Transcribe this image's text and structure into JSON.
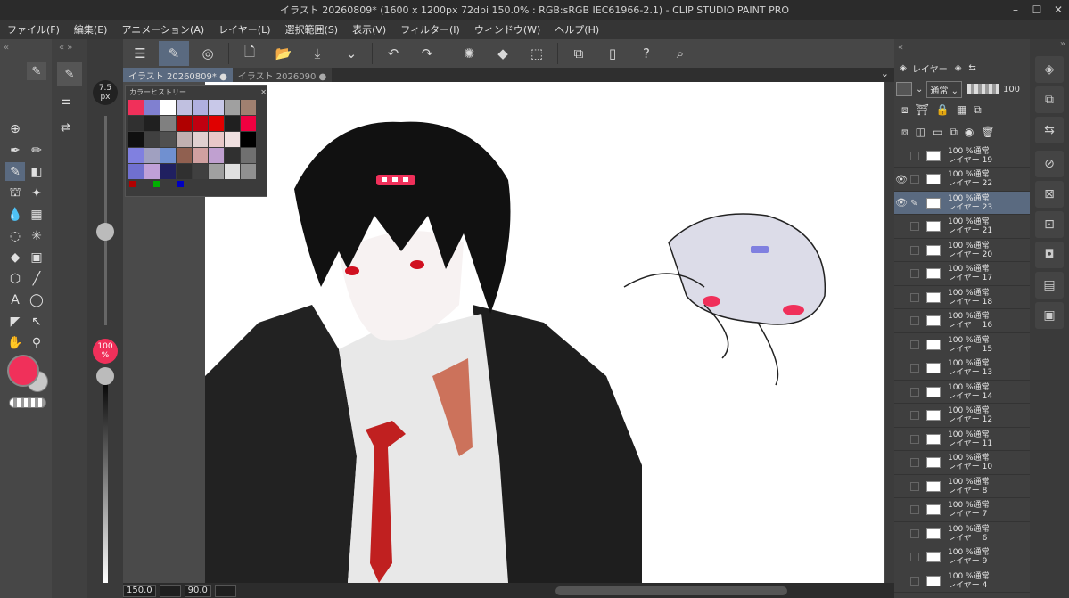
{
  "window": {
    "title": "イラスト 20260809* (1600 x 1200px 72dpi 150.0% : RGB:sRGB IEC61966-2.1) - CLIP STUDIO PAINT PRO",
    "min_icon": "minimize-icon",
    "max_icon": "maximize-icon",
    "close_icon": "close-icon"
  },
  "menu": [
    "ファイル(F)",
    "編集(E)",
    "アニメーション(A)",
    "レイヤー(L)",
    "選択範囲(S)",
    "表示(V)",
    "フィルター(I)",
    "ウィンドウ(W)",
    "ヘルプ(H)"
  ],
  "tabs": [
    {
      "label": "イラスト 20260809*",
      "active": true
    },
    {
      "label": "イラスト 2026090",
      "active": false
    }
  ],
  "brush": {
    "size": "7.5",
    "unit": "px",
    "opacity": "100",
    "opacity_unit": "%"
  },
  "colors": {
    "main": "#f0305a",
    "sub": "#c8c8c8",
    "accent": "#5a6a80"
  },
  "color_history": {
    "title": "カラーヒストリー",
    "swatches": [
      "#f0305a",
      "#8080d0",
      "#ffffff",
      "#c0c0e0",
      "#b0b0e0",
      "#c8c8e8",
      "#a0a0a0",
      "#a08070",
      "#303030",
      "#202020",
      "#808080",
      "#b00000",
      "#c00010",
      "#e00000",
      "#202020",
      "#f00040",
      "#101010",
      "#404040",
      "#505050",
      "#c0b0b0",
      "#e0d0d0",
      "#e8c8c8",
      "#f0e0e0",
      "#000000",
      "#8080e0",
      "#a0a0c0",
      "#7090d0",
      "#906050",
      "#d0a0a0",
      "#c0a0d0",
      "#303030",
      "#707070",
      "#7070d0",
      "#c0a0d8",
      "#202060",
      "#303030",
      "#404040",
      "#a0a0a0",
      "#e0e0e0",
      "#909090"
    ]
  },
  "layer_panel": {
    "header": "レイヤー",
    "blend_mode": "通常",
    "opacity": "100",
    "layers": [
      {
        "pct": "100 %通常",
        "name": "レイヤー 19",
        "visible": false,
        "selected": false
      },
      {
        "pct": "100 %通常",
        "name": "レイヤー 22",
        "visible": true,
        "selected": false
      },
      {
        "pct": "100 %通常",
        "name": "レイヤー 23",
        "visible": true,
        "selected": true
      },
      {
        "pct": "100 %通常",
        "name": "レイヤー 21",
        "visible": false,
        "selected": false
      },
      {
        "pct": "100 %通常",
        "name": "レイヤー 20",
        "visible": false,
        "selected": false
      },
      {
        "pct": "100 %通常",
        "name": "レイヤー 17",
        "visible": false,
        "selected": false
      },
      {
        "pct": "100 %通常",
        "name": "レイヤー 18",
        "visible": false,
        "selected": false
      },
      {
        "pct": "100 %通常",
        "name": "レイヤー 16",
        "visible": false,
        "selected": false
      },
      {
        "pct": "100 %通常",
        "name": "レイヤー 15",
        "visible": false,
        "selected": false
      },
      {
        "pct": "100 %通常",
        "name": "レイヤー 13",
        "visible": false,
        "selected": false
      },
      {
        "pct": "100 %通常",
        "name": "レイヤー 14",
        "visible": false,
        "selected": false
      },
      {
        "pct": "100 %通常",
        "name": "レイヤー 12",
        "visible": false,
        "selected": false
      },
      {
        "pct": "100 %通常",
        "name": "レイヤー 11",
        "visible": false,
        "selected": false
      },
      {
        "pct": "100 %通常",
        "name": "レイヤー 10",
        "visible": false,
        "selected": false
      },
      {
        "pct": "100 %通常",
        "name": "レイヤー 8",
        "visible": false,
        "selected": false
      },
      {
        "pct": "100 %通常",
        "name": "レイヤー 7",
        "visible": false,
        "selected": false
      },
      {
        "pct": "100 %通常",
        "name": "レイヤー 6",
        "visible": false,
        "selected": false
      },
      {
        "pct": "100 %通常",
        "name": "レイヤー 9",
        "visible": false,
        "selected": false
      },
      {
        "pct": "100 %通常",
        "name": "レイヤー 4",
        "visible": false,
        "selected": false
      }
    ]
  },
  "status": {
    "zoom": "150.0",
    "angle": "90.0"
  }
}
